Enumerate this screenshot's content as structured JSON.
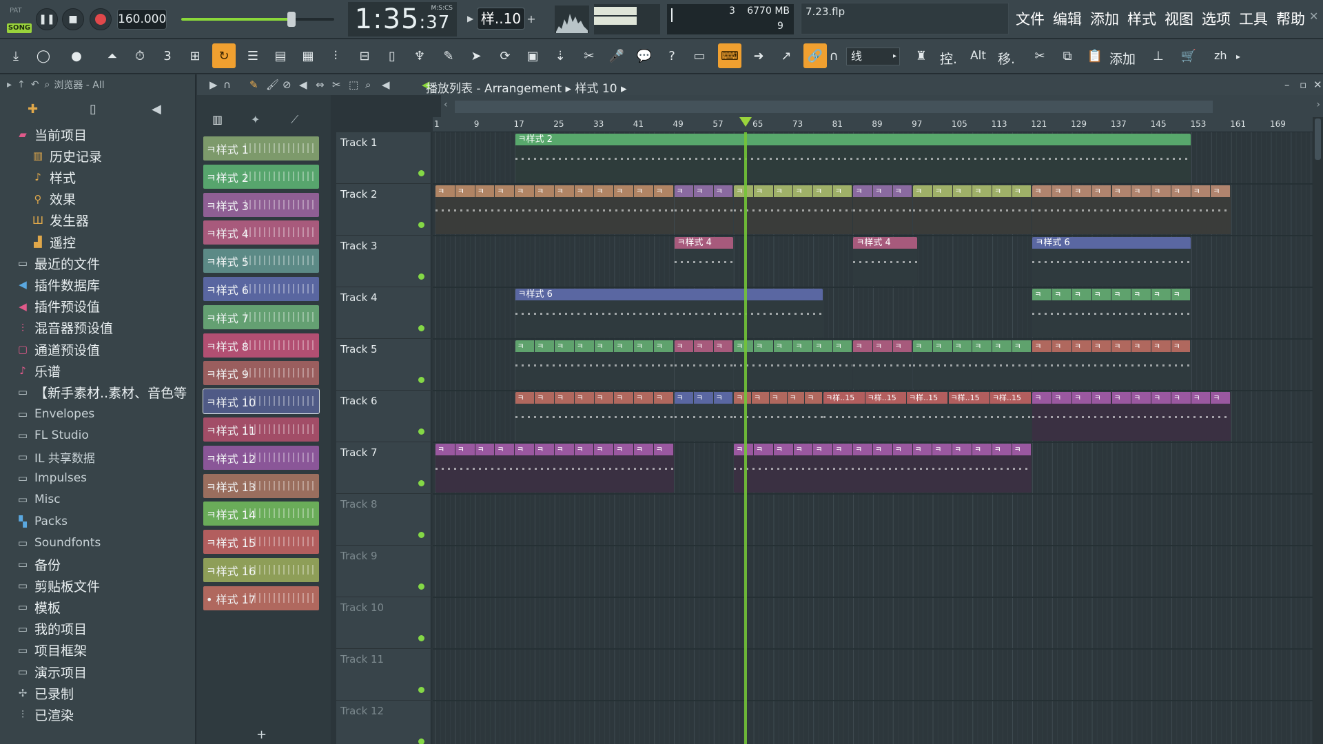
{
  "transport": {
    "mode_pat": "PAT",
    "mode_song": "SONG",
    "tempo": "160.000",
    "master_volume": 0.72,
    "time": "1:35",
    "time_sub": ":37",
    "time_unit": "M:S:CS",
    "pattern_selector": "样..10",
    "cpu_label": "3",
    "ram": "6770 MB",
    "poly": "9",
    "file_name": "7.23.flp"
  },
  "menu": [
    "文件",
    "编辑",
    "添加",
    "样式",
    "视图",
    "选项",
    "工具",
    "帮助"
  ],
  "toolbar": {
    "snap": "线",
    "ctrl_label": "控.",
    "alt_label": "Alt",
    "move_label": "移.",
    "add_label": "添加",
    "lang": "zh"
  },
  "browser": {
    "header": "浏览器 - All",
    "items": [
      {
        "icon": "folder-open-icon",
        "label": "当前项目",
        "en": false,
        "indent": 0
      },
      {
        "icon": "history-icon",
        "label": "历史记录",
        "en": false,
        "indent": 1
      },
      {
        "icon": "note-icon",
        "label": "样式",
        "en": false,
        "indent": 1
      },
      {
        "icon": "effect-icon",
        "label": "效果",
        "en": false,
        "indent": 1
      },
      {
        "icon": "generator-icon",
        "label": "发生器",
        "en": false,
        "indent": 1
      },
      {
        "icon": "remote-icon",
        "label": "遥控",
        "en": false,
        "indent": 1
      },
      {
        "icon": "folder-icon",
        "label": "最近的文件",
        "en": false,
        "indent": 0
      },
      {
        "icon": "plugin-db-icon",
        "label": "插件数据库",
        "en": false,
        "indent": 0
      },
      {
        "icon": "plugin-preset-icon",
        "label": "插件预设值",
        "en": false,
        "indent": 0
      },
      {
        "icon": "mixer-preset-icon",
        "label": "混音器预设值",
        "en": false,
        "indent": 0
      },
      {
        "icon": "channel-preset-icon",
        "label": "通道预设值",
        "en": false,
        "indent": 0
      },
      {
        "icon": "score-icon",
        "label": "乐谱",
        "en": false,
        "indent": 0
      },
      {
        "icon": "folder-icon",
        "label": "【新手素材..素材、音色等",
        "en": false,
        "indent": 0
      },
      {
        "icon": "folder-icon",
        "label": "Envelopes",
        "en": true,
        "indent": 0
      },
      {
        "icon": "folder-icon",
        "label": "FL Studio",
        "en": true,
        "indent": 0
      },
      {
        "icon": "folder-icon",
        "label": "IL 共享数据",
        "en": true,
        "indent": 0
      },
      {
        "icon": "folder-icon",
        "label": "Impulses",
        "en": true,
        "indent": 0
      },
      {
        "icon": "folder-icon",
        "label": "Misc",
        "en": true,
        "indent": 0
      },
      {
        "icon": "packs-icon",
        "label": "Packs",
        "en": true,
        "indent": 0
      },
      {
        "icon": "folder-icon",
        "label": "Soundfonts",
        "en": true,
        "indent": 0
      },
      {
        "icon": "folder-icon",
        "label": "备份",
        "en": false,
        "indent": 0
      },
      {
        "icon": "folder-icon",
        "label": "剪贴板文件",
        "en": false,
        "indent": 0
      },
      {
        "icon": "folder-icon",
        "label": "模板",
        "en": false,
        "indent": 0
      },
      {
        "icon": "folder-icon",
        "label": "我的项目",
        "en": false,
        "indent": 0
      },
      {
        "icon": "folder-icon",
        "label": "项目框架",
        "en": false,
        "indent": 0
      },
      {
        "icon": "folder-icon",
        "label": "演示项目",
        "en": false,
        "indent": 0
      },
      {
        "icon": "recorded-icon",
        "label": "已录制",
        "en": false,
        "indent": 0
      },
      {
        "icon": "rendered-icon",
        "label": "已渲染",
        "en": false,
        "indent": 0
      }
    ]
  },
  "playlist": {
    "title_a": "播放列表 - Arrangement",
    "title_b": "样式 10",
    "patterns": [
      {
        "label": "样式 1",
        "color": "#7d9a6b"
      },
      {
        "label": "样式 2",
        "color": "#57a56d"
      },
      {
        "label": "样式 3",
        "color": "#8f5f94"
      },
      {
        "label": "样式 4",
        "color": "#a85a7c"
      },
      {
        "label": "样式 5",
        "color": "#5c8a86"
      },
      {
        "label": "样式 6",
        "color": "#5966a0"
      },
      {
        "label": "样式 7",
        "color": "#64a072"
      },
      {
        "label": "样式 8",
        "color": "#b24f72"
      },
      {
        "label": "样式 9",
        "color": "#9a5e5e"
      },
      {
        "label": "样式 10",
        "color": "#4f5a86"
      },
      {
        "label": "样式 11",
        "color": "#a24d67"
      },
      {
        "label": "样式 12",
        "color": "#8a5698"
      },
      {
        "label": "样式 13",
        "color": "#9a6e5e"
      },
      {
        "label": "样式 14",
        "color": "#6aac59"
      },
      {
        "label": "样式 15",
        "color": "#b25e5e"
      },
      {
        "label": "样式 16",
        "color": "#8e9e58"
      },
      {
        "label": "• 样式 17",
        "color": "#b0685e"
      }
    ],
    "tracks": [
      "Track 1",
      "Track 2",
      "Track 3",
      "Track 4",
      "Track 5",
      "Track 6",
      "Track 7",
      "Track 8",
      "Track 9",
      "Track 10",
      "Track 11",
      "Track 12"
    ],
    "bar_ticks": [
      "1",
      "9",
      "17",
      "25",
      "33",
      "41",
      "49",
      "57",
      "65",
      "73",
      "81",
      "89",
      "97",
      "105",
      "113",
      "121",
      "129",
      "137",
      "145",
      "153",
      "161",
      "169"
    ],
    "playhead_bar": 63,
    "clips": [
      {
        "track": 0,
        "start": 17,
        "end": 153,
        "label": "样式 2",
        "color": "#58a86c",
        "body": "#2e3c3b"
      },
      {
        "track": 1,
        "start": 1,
        "end": 49,
        "label": "",
        "color": "#b08464",
        "body": "#3a3c3a",
        "rep": 4
      },
      {
        "track": 1,
        "start": 49,
        "end": 61,
        "label": "",
        "color": "#8a6aa0",
        "body": "#3a3c3a",
        "rep": 4
      },
      {
        "track": 1,
        "start": 61,
        "end": 85,
        "label": "",
        "color": "#9fb068",
        "body": "#3a3c3a",
        "rep": 4
      },
      {
        "track": 1,
        "start": 85,
        "end": 97,
        "label": "",
        "color": "#8a6aa0",
        "body": "#3a3c3a",
        "rep": 4
      },
      {
        "track": 1,
        "start": 97,
        "end": 121,
        "label": "",
        "color": "#9fb068",
        "body": "#3a3c3a",
        "rep": 4
      },
      {
        "track": 1,
        "start": 121,
        "end": 161,
        "label": "",
        "color": "#b0846e",
        "body": "#3a3c3a",
        "rep": 4
      },
      {
        "track": 2,
        "start": 49,
        "end": 61,
        "label": "样式 4",
        "color": "#a75a7c",
        "body": "#2f3a3e"
      },
      {
        "track": 2,
        "start": 85,
        "end": 98,
        "label": "样式 4",
        "color": "#a75a7c",
        "body": "#2f3a3e"
      },
      {
        "track": 2,
        "start": 121,
        "end": 153,
        "label": "样式 6",
        "color": "#5a67a2",
        "body": "#2f3a3e"
      },
      {
        "track": 3,
        "start": 17,
        "end": 79,
        "label": "样式 6",
        "color": "#5a67a2",
        "body": "#2f3a3e"
      },
      {
        "track": 3,
        "start": 121,
        "end": 153,
        "label": "",
        "color": "#5fa26d",
        "body": "#2f3a3e",
        "rep": 4
      },
      {
        "track": 4,
        "start": 17,
        "end": 49,
        "label": "",
        "color": "#5fa26d",
        "body": "#2f3a3e",
        "rep": 4
      },
      {
        "track": 4,
        "start": 49,
        "end": 61,
        "label": "",
        "color": "#a75a7c",
        "body": "#2f3a3e",
        "rep": 4
      },
      {
        "track": 4,
        "start": 61,
        "end": 85,
        "label": "",
        "color": "#5fa26d",
        "body": "#2f3a3e",
        "rep": 4
      },
      {
        "track": 4,
        "start": 85,
        "end": 97,
        "label": "",
        "color": "#a75a7c",
        "body": "#2f3a3e",
        "rep": 4
      },
      {
        "track": 4,
        "start": 97,
        "end": 121,
        "label": "",
        "color": "#5fa26d",
        "body": "#2f3a3e",
        "rep": 4
      },
      {
        "track": 4,
        "start": 121,
        "end": 153,
        "label": "",
        "color": "#b0685e",
        "body": "#2f3a3e",
        "rep": 4
      },
      {
        "track": 5,
        "start": 17,
        "end": 49,
        "label": "",
        "color": "#b0685e",
        "body": "#2f3a3e",
        "rep": 4
      },
      {
        "track": 5,
        "start": 49,
        "end": 61,
        "label": "",
        "color": "#5a67a2",
        "body": "#2f3a3e",
        "rep": 4
      },
      {
        "track": 5,
        "start": 61,
        "end": 79,
        "label": "",
        "color": "#b0685e",
        "body": "#2f3a3e",
        "rep": 4
      },
      {
        "track": 5,
        "start": 79,
        "end": 121,
        "label": "样..15",
        "color": "#b25e5e",
        "body": "#2f3a3e",
        "rep": 8
      },
      {
        "track": 5,
        "start": 121,
        "end": 161,
        "label": "",
        "color": "#9a58a0",
        "body": "#3a3042",
        "rep": 4
      },
      {
        "track": 6,
        "start": 1,
        "end": 49,
        "label": "",
        "color": "#9a58a0",
        "body": "#3a3042",
        "rep": 4
      },
      {
        "track": 6,
        "start": 61,
        "end": 121,
        "label": "",
        "color": "#9a58a0",
        "body": "#3a3042",
        "rep": 4
      }
    ]
  }
}
